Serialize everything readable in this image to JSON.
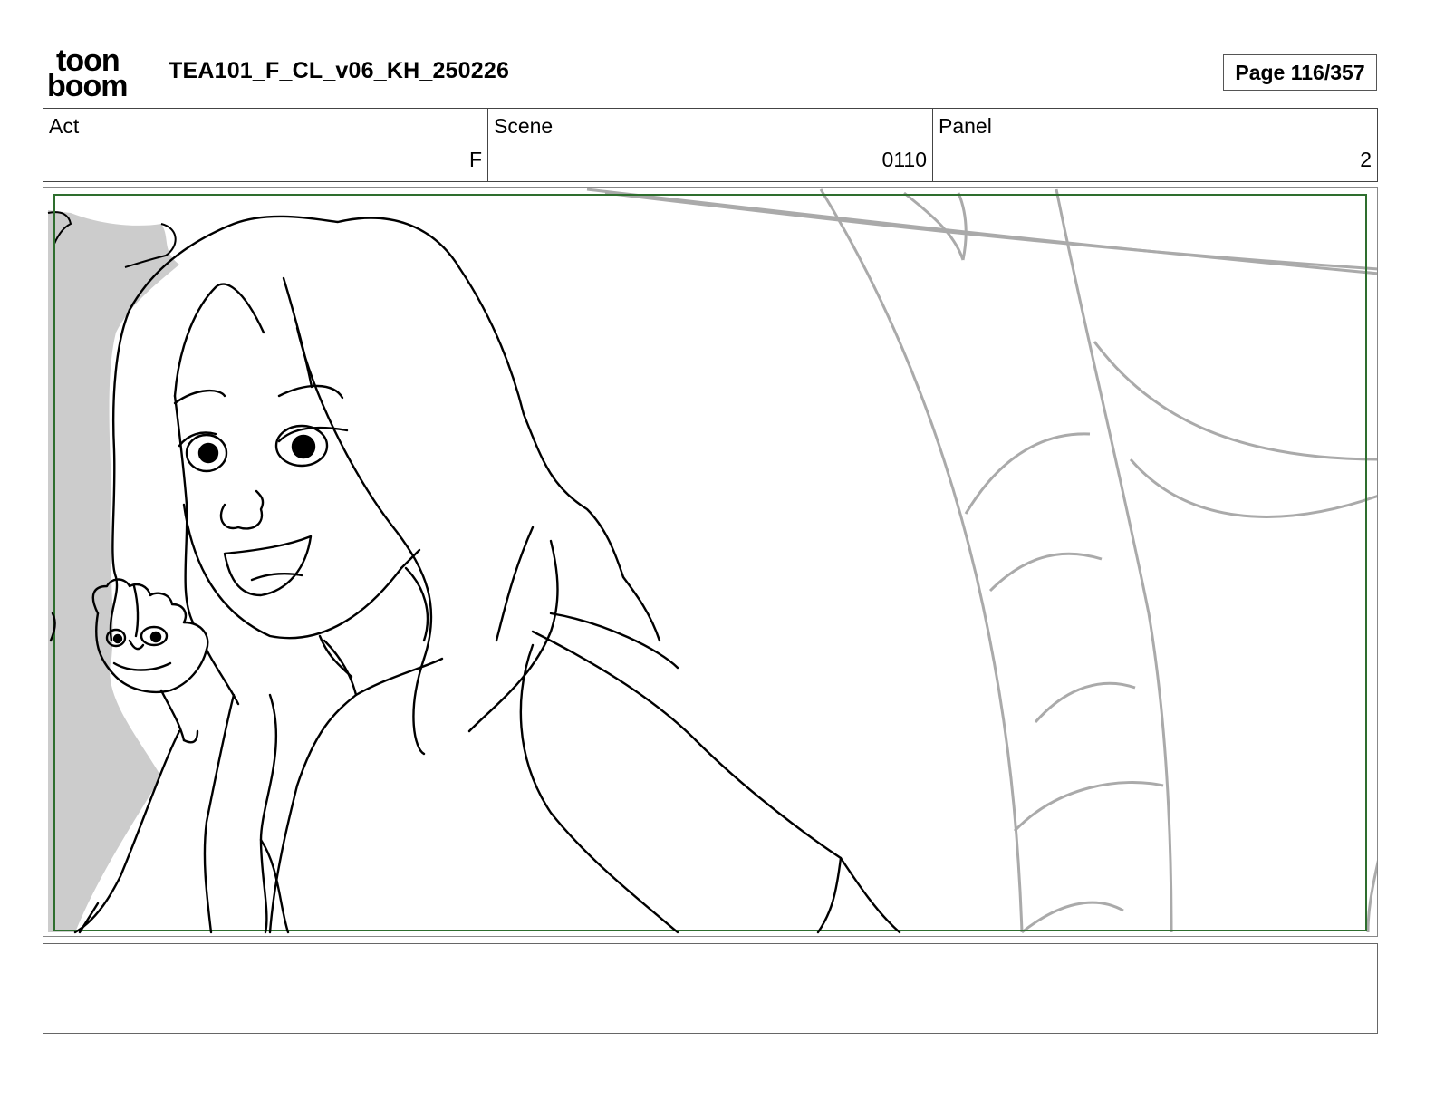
{
  "header": {
    "logo_top": "toon",
    "logo_bottom": "boom",
    "document_title": "TEA101_F_CL_v06_KH_250226",
    "page_indicator": "Page 116/357"
  },
  "info": {
    "act_label": "Act",
    "act_value": "F",
    "scene_label": "Scene",
    "scene_value": "0110",
    "panel_label": "Panel",
    "panel_value": "2"
  },
  "notes": {
    "text": ""
  }
}
